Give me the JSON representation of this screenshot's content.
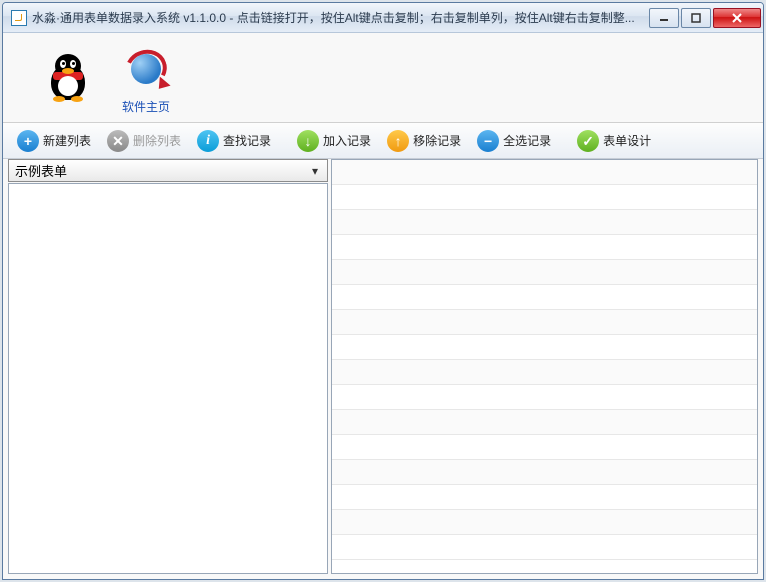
{
  "titlebar": {
    "text": "水淼·通用表单数据录入系统 v1.1.0.0 - 点击链接打开，按住Alt键点击复制；右击复制单列，按住Alt键右击复制整..."
  },
  "iconbar": {
    "qq_label": "",
    "home_label": "软件主页"
  },
  "toolbar": {
    "new_list": "新建列表",
    "delete_list": "删除列表",
    "find_record": "查找记录",
    "add_record": "加入记录",
    "remove_record": "移除记录",
    "select_all": "全选记录",
    "form_design": "表单设计"
  },
  "dropdown": {
    "selected": "示例表单"
  },
  "grid_row_count": 16
}
